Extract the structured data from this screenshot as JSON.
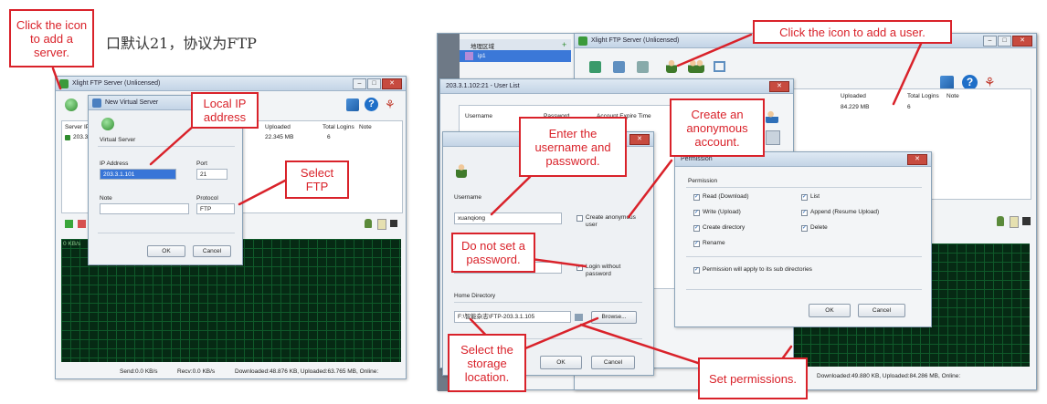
{
  "doc": {
    "chinese_heading": "口默认21，协议为FTP"
  },
  "left_app": {
    "title": "Xlight FTP Server (Unlicensed)",
    "columns": [
      "Server IP",
      "Uploaded",
      "Total Logins",
      "Note"
    ],
    "row": {
      "ip": "203.3",
      "uploaded": "22.345 MB",
      "logins": "6"
    },
    "status": {
      "send": "Send:0.0 KB/s",
      "recv": "Recv:0.0 KB/s",
      "downloaded": "Downloaded:48.876 KB, Uploaded:63.765 MB, Online:"
    },
    "graph_label": "0 KB/s"
  },
  "virtual_server_dialog": {
    "title": "New Virtual Server",
    "group_label": "Virtual Server",
    "ip_label": "IP Address",
    "ip_value": "203.3.1.101",
    "port_label": "Port",
    "port_value": "21",
    "note_label": "Note",
    "protocol_label": "Protocol",
    "protocol_value": "FTP",
    "ok": "OK",
    "cancel": "Cancel"
  },
  "right_app": {
    "title": "Xlight FTP Server (Unlicensed)",
    "tree": {
      "group": "地理区域",
      "item": "ip1"
    },
    "columns": [
      "Uploaded",
      "Total Logins",
      "Note"
    ],
    "row": {
      "uploaded": "84.229 MB",
      "logins": "6"
    },
    "status": "Downloaded:49.880 KB, Uploaded:84.286 MB, Online:"
  },
  "user_list": {
    "title": "203.3.1.102:21 - User List",
    "columns": [
      "Username",
      "Password",
      "Account Expire Time"
    ]
  },
  "user_dialog": {
    "username_label": "Username",
    "username_value": "xuanqiong",
    "anon_label": "Create anonymous user",
    "login_without_pw": "Login without password",
    "home_label": "Home Directory",
    "home_value": "F:\\智能杂志\\FTP-203.3.1.105",
    "browse": "Browse...",
    "ok": "OK",
    "cancel": "Cancel"
  },
  "permission_dialog": {
    "title": "Permission",
    "group_label": "Permission",
    "items": [
      "Read (Download)",
      "List",
      "Write (Upload)",
      "Append (Resume Upload)",
      "Create directory",
      "Delete",
      "Rename"
    ],
    "subdir": "Permission will apply to its sub directories",
    "ok": "OK",
    "cancel": "Cancel"
  },
  "callouts": {
    "add_server": "Click the icon to add a server.",
    "local_ip": "Local IP address",
    "select_ftp": "Select FTP",
    "add_user": "Click the icon to add a user.",
    "enter_user": "Enter the username and password.",
    "anonymous": "Create an anonymous account.",
    "no_password": "Do not set a password.",
    "storage": "Select the storage location.",
    "permissions": "Set permissions."
  },
  "colors": {
    "callout": "#d9222a",
    "graph": "#062a14"
  }
}
